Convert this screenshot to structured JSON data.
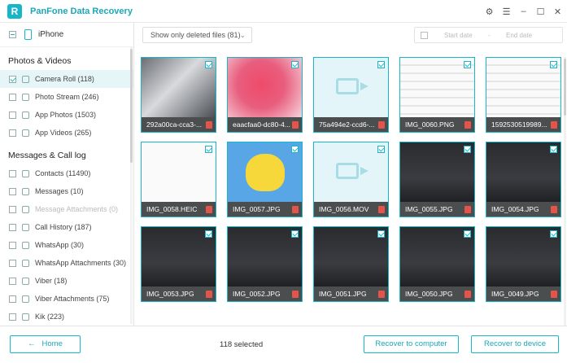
{
  "app": {
    "title": "PanFone Data Recovery",
    "logo_letter": "R"
  },
  "window": {
    "settings_icon": "gear-icon",
    "menu_icon": "hamburger-icon",
    "min_icon": "minimize-icon",
    "max_icon": "maximize-icon",
    "close_icon": "close-icon"
  },
  "device": {
    "name": "iPhone"
  },
  "sections": [
    {
      "title": "Photos & Videos",
      "items": [
        {
          "label": "Camera Roll (118)",
          "icon": "camera-icon",
          "checked": true,
          "selected": true
        },
        {
          "label": "Photo Stream (246)",
          "icon": "cloud-icon",
          "checked": false
        },
        {
          "label": "App Photos (1503)",
          "icon": "image-icon",
          "checked": false
        },
        {
          "label": "App Videos (265)",
          "icon": "video-icon",
          "checked": false
        }
      ]
    },
    {
      "title": "Messages & Call log",
      "items": [
        {
          "label": "Contacts (11490)",
          "icon": "contacts-icon",
          "checked": false
        },
        {
          "label": "Messages (10)",
          "icon": "message-icon",
          "checked": false
        },
        {
          "label": "Message Attachments (0)",
          "icon": "attachment-icon",
          "checked": false,
          "disabled": true
        },
        {
          "label": "Call History (187)",
          "icon": "phone-icon",
          "checked": false
        },
        {
          "label": "WhatsApp (30)",
          "icon": "whatsapp-icon",
          "checked": false
        },
        {
          "label": "WhatsApp Attachments (30)",
          "icon": "paperclip-icon",
          "checked": false
        },
        {
          "label": "Viber (18)",
          "icon": "viber-icon",
          "checked": false
        },
        {
          "label": "Viber Attachments (75)",
          "icon": "paperclip-icon",
          "checked": false
        },
        {
          "label": "Kik (223)",
          "icon": "kik-icon",
          "checked": false
        }
      ]
    }
  ],
  "filter": {
    "label": "Show only deleted files (81)"
  },
  "dates": {
    "start": "Start date",
    "separator": "-",
    "end": "End date"
  },
  "tiles": [
    {
      "name": "292a00ca-cca3-...",
      "kind": "phoneimg"
    },
    {
      "name": "eaacfaa0-dc80-4...",
      "kind": "pink"
    },
    {
      "name": "75a494e2-ccd6-...",
      "kind": "video"
    },
    {
      "name": "IMG_0060.PNG",
      "kind": "doc"
    },
    {
      "name": "1592530519989...",
      "kind": "doc"
    },
    {
      "name": "IMG_0058.HEIC",
      "kind": "sketch"
    },
    {
      "name": "IMG_0057.JPG",
      "kind": "pika"
    },
    {
      "name": "IMG_0056.MOV",
      "kind": "video"
    },
    {
      "name": "IMG_0055.JPG",
      "kind": "kbd"
    },
    {
      "name": "IMG_0054.JPG",
      "kind": "kbd"
    },
    {
      "name": "IMG_0053.JPG",
      "kind": "kbd"
    },
    {
      "name": "IMG_0052.JPG",
      "kind": "kbd"
    },
    {
      "name": "IMG_0051.JPG",
      "kind": "kbd"
    },
    {
      "name": "IMG_0050.JPG",
      "kind": "kbd"
    },
    {
      "name": "IMG_0049.JPG",
      "kind": "kbd"
    }
  ],
  "footer": {
    "home": "Home",
    "home_arrow": "←",
    "selected": "118 selected",
    "recover_computer": "Recover to computer",
    "recover_device": "Recover to device"
  }
}
